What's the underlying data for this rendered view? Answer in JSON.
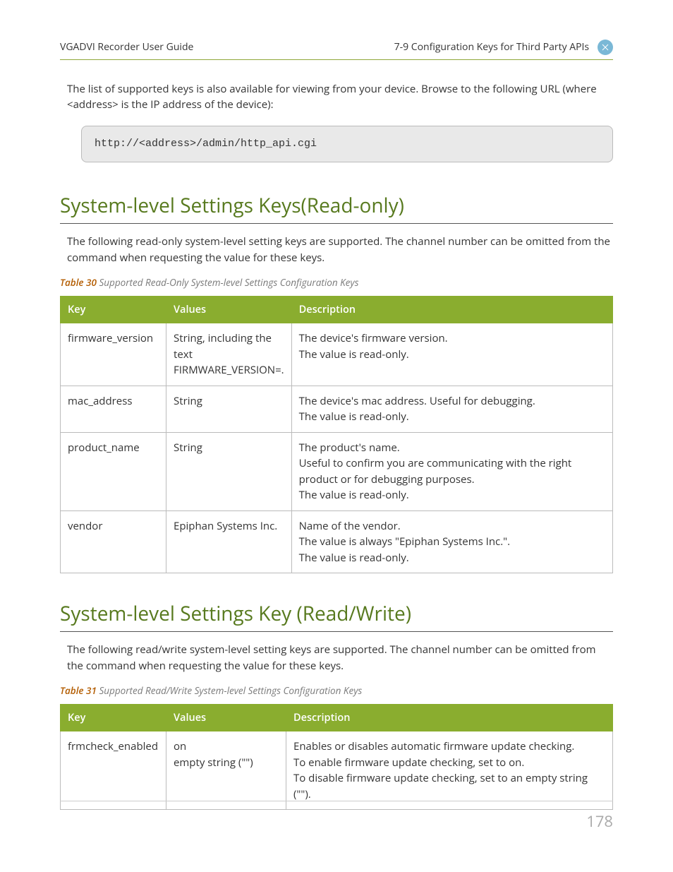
{
  "header": {
    "left": "VGADVI Recorder User Guide",
    "right": "7-9 Configuration Keys for Third Party APIs"
  },
  "intro": "The list of supported keys is also available for viewing from your device. Browse to the following URL (where <address> is the IP address of the device):",
  "code": "http://<address>/admin/http_api.cgi",
  "section1": {
    "title": "System-level Settings Keys(Read-only)",
    "intro": "The following read-only system-level setting keys are supported. The channel number can be omitted from the command when requesting the value for these keys.",
    "caption_label": "Table 30",
    "caption_text": "Supported Read-Only System-level Settings Configuration Keys",
    "headers": {
      "key": "Key",
      "values": "Values",
      "description": "Description"
    },
    "rows": [
      {
        "key": "firmware_version",
        "values": "String, including the text FIRMWARE_VERSION=.",
        "desc": [
          "The device's firmware version.",
          "The value is read-only."
        ]
      },
      {
        "key": "mac_address",
        "values": "String",
        "desc": [
          "The device's mac address. Useful for debugging.",
          "The value is read-only."
        ]
      },
      {
        "key": "product_name",
        "values": "String",
        "desc": [
          "The product's name.",
          "Useful to confirm you are communicating with the right product or for debugging purposes.",
          "The value is read-only."
        ]
      },
      {
        "key": "vendor",
        "values": "Epiphan Systems Inc.",
        "desc": [
          "Name of the vendor.",
          "The value is always \"Epiphan Systems Inc.\".",
          "The value is read-only."
        ]
      }
    ]
  },
  "section2": {
    "title": "System-level Settings Key (Read/Write)",
    "intro": "The following read/write system-level setting keys are supported. The channel number can be omitted from the command when requesting the value for these keys.",
    "caption_label": "Table 31",
    "caption_text": "Supported Read/Write System-level Settings Configuration Keys",
    "headers": {
      "key": "Key",
      "values": "Values",
      "description": "Description"
    },
    "rows": [
      {
        "key": "frmcheck_enabled",
        "values": "on\nempty string (\"\")",
        "desc": [
          "Enables or disables automatic firmware update checking.",
          "To enable firmware update checking, set to on.",
          "To disable firmware update checking, set to an empty string (\"\")."
        ]
      }
    ]
  },
  "page_number": "178"
}
